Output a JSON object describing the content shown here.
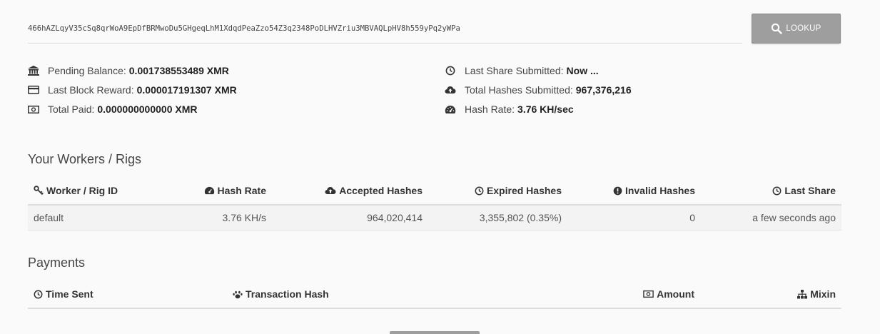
{
  "search": {
    "address": "466hAZLqyV35cSq8qrWoA9EpDfBRMwoDu5GHgeqLhM1XdqdPeaZzo54Z3q2348PoDLHVZriu3MBVAQLpHV8h559yPq2yWPa",
    "button_label": "LOOKUP"
  },
  "stats_left": [
    {
      "icon": "bank-icon",
      "label": "Pending Balance:",
      "value": "0.001738553489 XMR"
    },
    {
      "icon": "credit-card-icon",
      "label": "Last Block Reward:",
      "value": "0.000017191307 XMR"
    },
    {
      "icon": "money-icon",
      "label": "Total Paid:",
      "value": "0.000000000000 XMR"
    }
  ],
  "stats_right": [
    {
      "icon": "clock-icon",
      "label": "Last Share Submitted:",
      "value": "Now ..."
    },
    {
      "icon": "cloud-upload-icon",
      "label": "Total Hashes Submitted:",
      "value": "967,376,216"
    },
    {
      "icon": "dashboard-icon",
      "label": "Hash Rate:",
      "value": "3.76 KH/sec"
    }
  ],
  "workers": {
    "title": "Your Workers / Rigs",
    "columns": [
      "Worker / Rig ID",
      "Hash Rate",
      "Accepted Hashes",
      "Expired Hashes",
      "Invalid Hashes",
      "Last Share"
    ],
    "rows": [
      [
        "default",
        "3.76 KH/s",
        "964,020,414",
        "3,355,802 (0.35%)",
        "0",
        "a few seconds ago"
      ]
    ]
  },
  "payments": {
    "title": "Payments",
    "columns": [
      "Time Sent",
      "Transaction Hash",
      "Amount",
      "Mixin"
    ]
  }
}
